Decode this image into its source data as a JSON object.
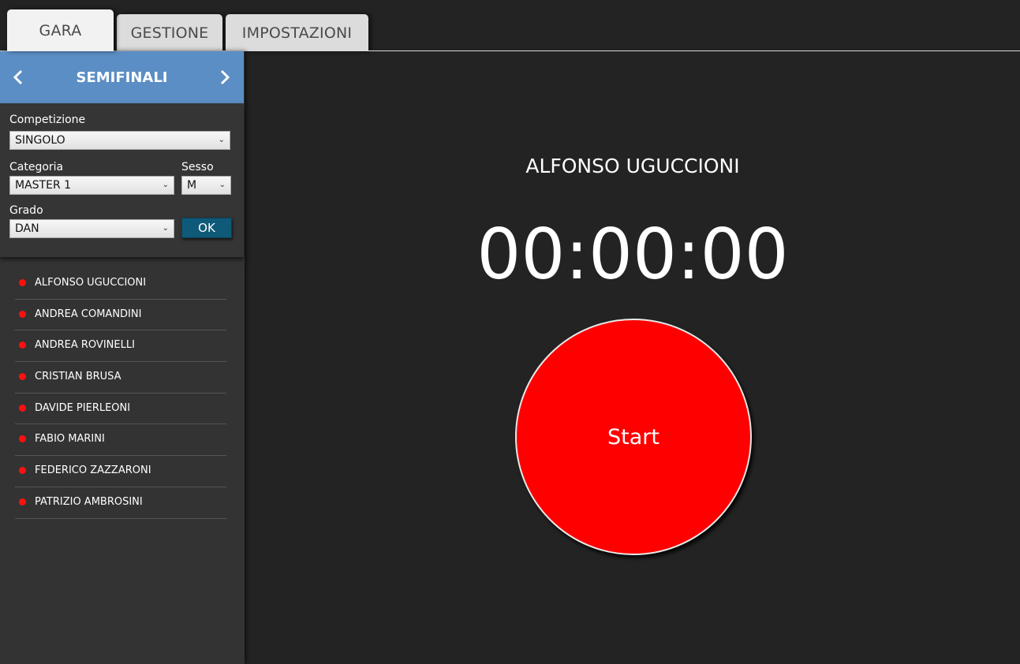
{
  "tabs": [
    {
      "label": "GARA",
      "active": true
    },
    {
      "label": "GESTIONE",
      "active": false
    },
    {
      "label": "IMPOSTAZIONI",
      "active": false
    }
  ],
  "sidebar": {
    "phase": {
      "title": "SEMIFINALI",
      "prev_icon": "chevron-left-icon",
      "next_icon": "chevron-right-icon",
      "header_color": "#5b8ec4"
    },
    "filters": {
      "competizione": {
        "label": "Competizione",
        "value": "SINGOLO"
      },
      "categoria": {
        "label": "Categoria",
        "value": "MASTER 1"
      },
      "sesso": {
        "label": "Sesso",
        "value": "M"
      },
      "grado": {
        "label": "Grado",
        "value": "DAN"
      },
      "ok_label": "OK"
    },
    "athletes": [
      "ALFONSO UGUCCIONI",
      "ANDREA COMANDINI",
      "ANDREA ROVINELLI",
      "CRISTIAN BRUSA",
      "DAVIDE PIERLEONI",
      "FABIO MARINI",
      "FEDERICO ZAZZARONI",
      "PATRIZIO AMBROSINI"
    ],
    "status_dot_color": "#ff1010"
  },
  "main": {
    "current_athlete": "ALFONSO UGUCCIONI",
    "timer": "00:00:00",
    "start_label": "Start",
    "start_color": "#ff0000"
  }
}
